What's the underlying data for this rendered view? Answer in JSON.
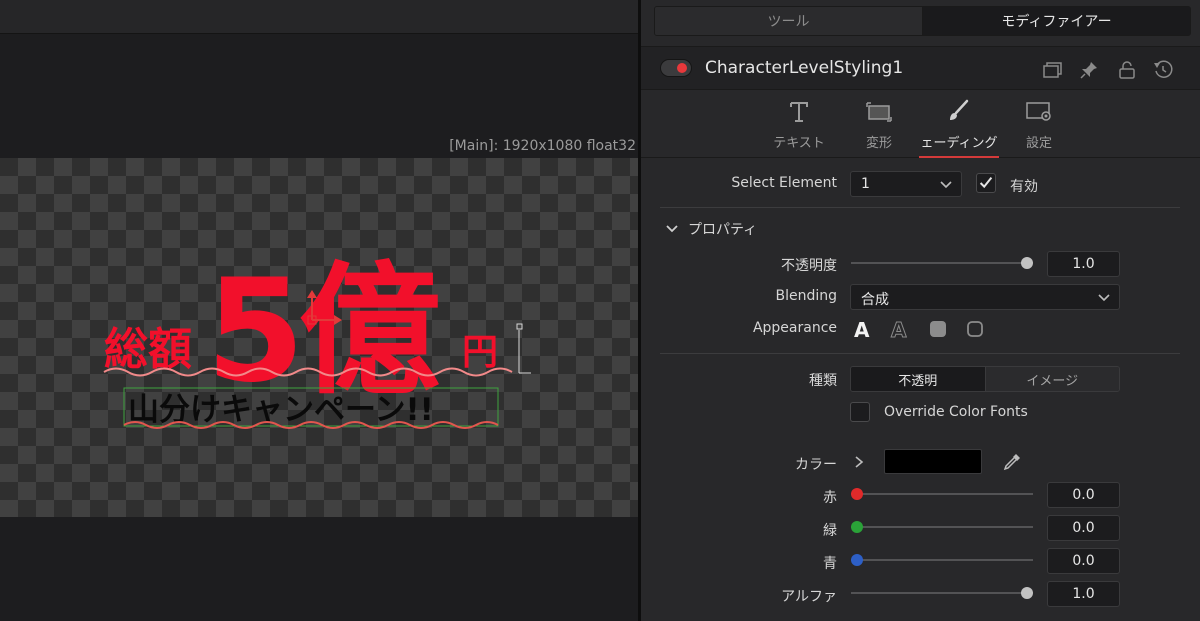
{
  "viewer": {
    "info": "[Main]: 1920x1080 float32",
    "canvas_text": {
      "line1_small": "総額",
      "line1_big": "5億",
      "line1_suffix": "円",
      "line2": "山分けキャンペーン!!"
    },
    "colors": {
      "headline": "#f2102b",
      "subline": "#0a0a0a"
    }
  },
  "inspector": {
    "tabs": [
      {
        "label": "ツール",
        "active": false
      },
      {
        "label": "モディファイアー",
        "active": true
      }
    ],
    "tool_name": "CharacterLevelStyling1",
    "header_icons": [
      "window-icon",
      "pin-icon",
      "lock-icon",
      "reset-icon"
    ],
    "subtabs": [
      {
        "label": "テキスト",
        "icon": "text-icon",
        "active": false
      },
      {
        "label": "変形",
        "icon": "transform-icon",
        "active": false
      },
      {
        "label": "ェーディング",
        "icon": "brush-icon",
        "active": true
      },
      {
        "label": "設定",
        "icon": "settings-icon",
        "active": false
      }
    ],
    "select_element": {
      "label": "Select Element",
      "value": "1",
      "enabled_label": "有効",
      "enabled": true
    },
    "section_title": "プロパティ",
    "opacity": {
      "label": "不透明度",
      "value": "1.0",
      "fraction": 1.0
    },
    "blending": {
      "label": "Blending",
      "value": "合成"
    },
    "appearance": {
      "label": "Appearance",
      "options": [
        "text-fill-icon",
        "text-outline-icon",
        "block-icon",
        "border-icon"
      ]
    },
    "type": {
      "label": "種類",
      "options": [
        "不透明",
        "イメージ"
      ],
      "selected": "不透明"
    },
    "override_color_fonts": {
      "label": "Override Color Fonts",
      "checked": false
    },
    "color": {
      "label": "カラー",
      "swatch": "#000000"
    },
    "red": {
      "label": "赤",
      "value": "0.0",
      "fraction": 0.0,
      "dot": "#e12a2a"
    },
    "green": {
      "label": "緑",
      "value": "0.0",
      "fraction": 0.0,
      "dot": "#2aa238"
    },
    "blue": {
      "label": "青",
      "value": "0.0",
      "fraction": 0.0,
      "dot": "#2d5fc6"
    },
    "alpha": {
      "label": "アルファ",
      "value": "1.0",
      "fraction": 1.0
    },
    "accent": "#d43a3a"
  }
}
